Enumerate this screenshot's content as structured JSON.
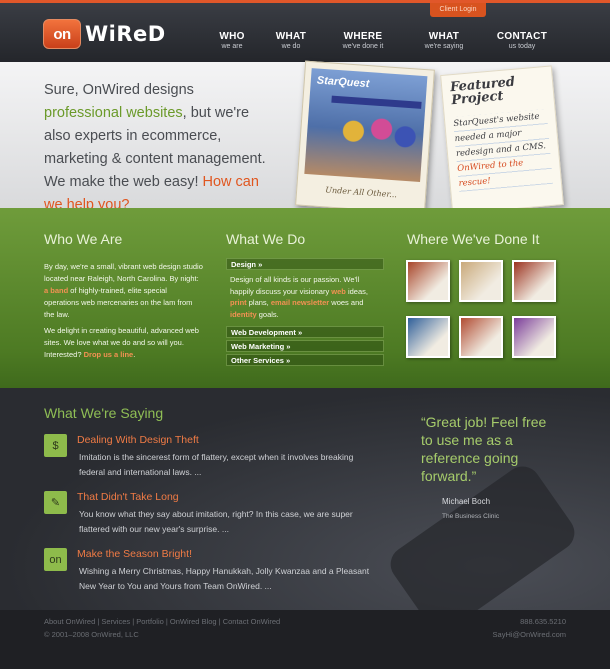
{
  "header": {
    "client_login": "Client Login",
    "logo_on": "on",
    "logo_wired": "WiReD",
    "nav": [
      {
        "title": "WHO",
        "sub": "we are"
      },
      {
        "title": "WHAT",
        "sub": "we do"
      },
      {
        "title": "WHERE",
        "sub": "we've done it"
      },
      {
        "title": "WHAT",
        "sub": "we're saying"
      },
      {
        "title": "CONTACT",
        "sub": "us today"
      }
    ]
  },
  "hero": {
    "intro_1": "Sure, OnWired designs ",
    "intro_green": "professional websites",
    "intro_2": ", but we're also experts in ecommerce, marketing & content management. We make the web easy! ",
    "intro_cta": "How can we help you?",
    "photo_logo": "StarQuest",
    "photo_caption": "Under All Other...",
    "note_title": "Featured Project",
    "note_body_1": "StarQuest's website needed a major redesign and a CMS. ",
    "note_body_red": "OnWired to the rescue!"
  },
  "who": {
    "heading": "Who We Are",
    "p1_a": "By day, we're a small, vibrant web design studio located near Raleigh, North Carolina. By night: ",
    "p1_link": "a band",
    "p1_b": " of highly-trained, elite special operations web mercenaries on the lam from the law.",
    "p2_a": "We delight in creating beautiful, advanced web sites. We love what we do and so will you. Interested? ",
    "p2_link": "Drop us a line",
    "p2_b": "."
  },
  "what": {
    "heading": "What We Do",
    "design_label": "Design »",
    "design_a": "Design of all kinds is our passion. We'll happily discuss your visionary ",
    "design_web": "web",
    "design_b": " ideas, ",
    "design_print": "print",
    "design_c": " plans, ",
    "design_news": "email newsletter",
    "design_d": " woes and ",
    "design_identity": "identity",
    "design_e": " goals.",
    "items": [
      "Web Development »",
      "Web Marketing »",
      "Other Services »"
    ]
  },
  "where": {
    "heading": "Where We've Done It",
    "thumbs": [
      "#a8452a",
      "#c9a97a",
      "#9c3320",
      "#2f5f9a",
      "#b14b32",
      "#7a3c9a"
    ]
  },
  "saying": {
    "heading": "What We're Saying",
    "posts": [
      {
        "icon": "money-bag-icon",
        "glyph": "$",
        "title": "Dealing With Design Theft",
        "body": "Imitation is the sincerest form of flattery, except when it involves breaking federal and international laws. ..."
      },
      {
        "icon": "pen-icon",
        "glyph": "✎",
        "title": "That Didn't Take Long",
        "body": "You know what they say about imitation, right? In this case, we are super flattered with our new year's surprise. ..."
      },
      {
        "icon": "onwired-logo-icon",
        "glyph": "on",
        "title": "Make the Season Bright!",
        "body": "Wishing a Merry Christmas, Happy Hanukkah, Jolly Kwanzaa and a Pleasant New Year to You and Yours from Team OnWired. ..."
      }
    ],
    "quote": "“Great job! Feel free to use me as a reference going forward.”",
    "quote_name": "Michael Boch",
    "quote_company": "The Business Clinic"
  },
  "footer": {
    "links": "About OnWired | Services | Portfolio | OnWired Blog | Contact OnWired",
    "copyright": "© 2001–2008 OnWired, LLC",
    "phone": "888.635.5210",
    "email": "SayHi@OnWired.com"
  }
}
